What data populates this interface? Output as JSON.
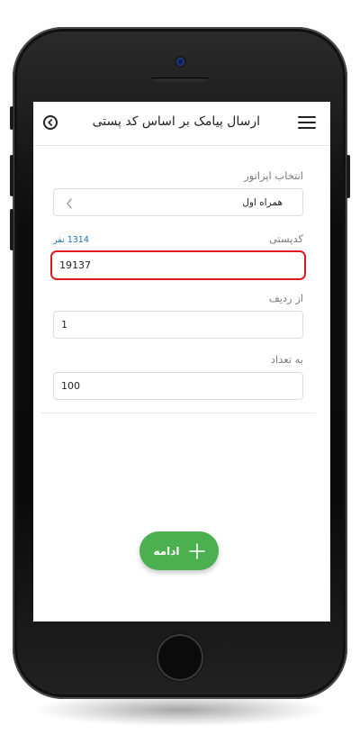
{
  "header": {
    "title": "ارسال پیامک بر اساس کد پستی",
    "back_icon": "back-arrow-circle-icon",
    "menu_icon": "hamburger-menu-icon"
  },
  "form": {
    "operator": {
      "label": "انتخاب اپراتور",
      "value": "همراه اول"
    },
    "postal_code": {
      "label": "کدپستی",
      "count": "1314 نفر",
      "value": "19137"
    },
    "from_row": {
      "label": "از ردیف",
      "value": "1"
    },
    "quantity": {
      "label": "به تعداد",
      "value": "100"
    }
  },
  "actions": {
    "continue_label": "ادامه"
  },
  "colors": {
    "accent": "#4caf50",
    "highlight": "#e0191e",
    "link": "#1e6fb8"
  }
}
